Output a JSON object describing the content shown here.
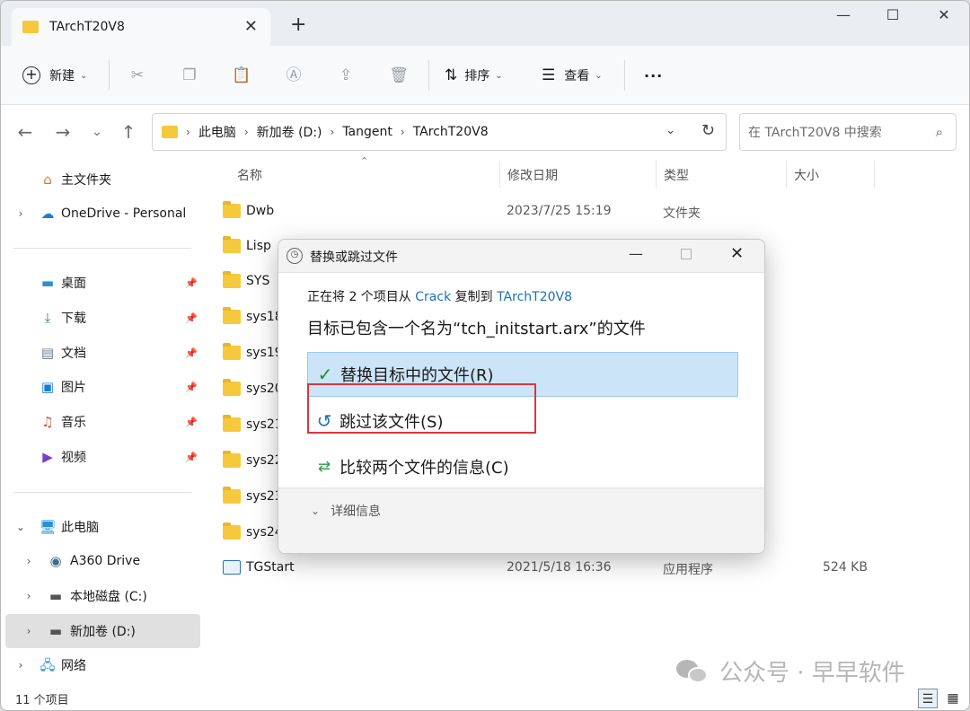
{
  "tab": {
    "title": "TArchT20V8",
    "close": "✕",
    "new": "+"
  },
  "window_controls": {
    "minimize": "—",
    "maximize": "☐",
    "close": "✕"
  },
  "toolbar": {
    "new_label": "新建",
    "sort_label": "排序",
    "view_label": "查看",
    "more_label": "···"
  },
  "address": {
    "crumbs": [
      "此电脑",
      "新加卷 (D:)",
      "Tangent",
      "TArchT20V8"
    ],
    "search_placeholder": "在 TArchT20V8 中搜索"
  },
  "sidebar": {
    "quick": "主文件夹",
    "onedrive": "OneDrive - Personal",
    "pinned": [
      "桌面",
      "下载",
      "文档",
      "图片",
      "音乐",
      "视频"
    ],
    "this_pc": "此电脑",
    "drives": [
      "A360 Drive",
      "本地磁盘 (C:)",
      "新加卷 (D:)"
    ],
    "network": "网络"
  },
  "columns": {
    "name": "名称",
    "date": "修改日期",
    "type": "类型",
    "size": "大小"
  },
  "files": [
    {
      "name": "Dwb",
      "date": "2023/7/25 15:19",
      "type": "文件夹",
      "size": ""
    },
    {
      "name": "Lisp",
      "date": "",
      "type": "",
      "size": ""
    },
    {
      "name": "SYS",
      "date": "",
      "type": "",
      "size": ""
    },
    {
      "name": "sys18",
      "date": "",
      "type": "",
      "size": ""
    },
    {
      "name": "sys19",
      "date": "",
      "type": "",
      "size": ""
    },
    {
      "name": "sys20",
      "date": "",
      "type": "",
      "size": ""
    },
    {
      "name": "sys21",
      "date": "",
      "type": "",
      "size": ""
    },
    {
      "name": "sys22",
      "date": "",
      "type": "",
      "size": ""
    },
    {
      "name": "sys23",
      "date": "",
      "type": "",
      "size": ""
    },
    {
      "name": "sys24",
      "date": "",
      "type": "",
      "size": ""
    },
    {
      "name": "TGStart",
      "date": "2021/5/18 16:36",
      "type": "应用程序",
      "size": "524 KB"
    }
  ],
  "status": {
    "count": "11 个项目"
  },
  "watermark": "公众号 · 早早软件",
  "dialog": {
    "title": "替换或跳过文件",
    "msg1_prefix": "正在将 2 个项目从 ",
    "msg1_source": "Crack",
    "msg1_mid": " 复制到 ",
    "msg1_target": "TArchT20V8",
    "msg2": "目标已包含一个名为“tch_initstart.arx”的文件",
    "options": [
      "替换目标中的文件(R)",
      "跳过该文件(S)",
      "比较两个文件的信息(C)"
    ],
    "details": "详细信息"
  },
  "colors": {
    "accent": "#1a6fb8",
    "highlight": "#cce4f7",
    "annotation": "#d9363e",
    "folder": "#f6c83c"
  }
}
